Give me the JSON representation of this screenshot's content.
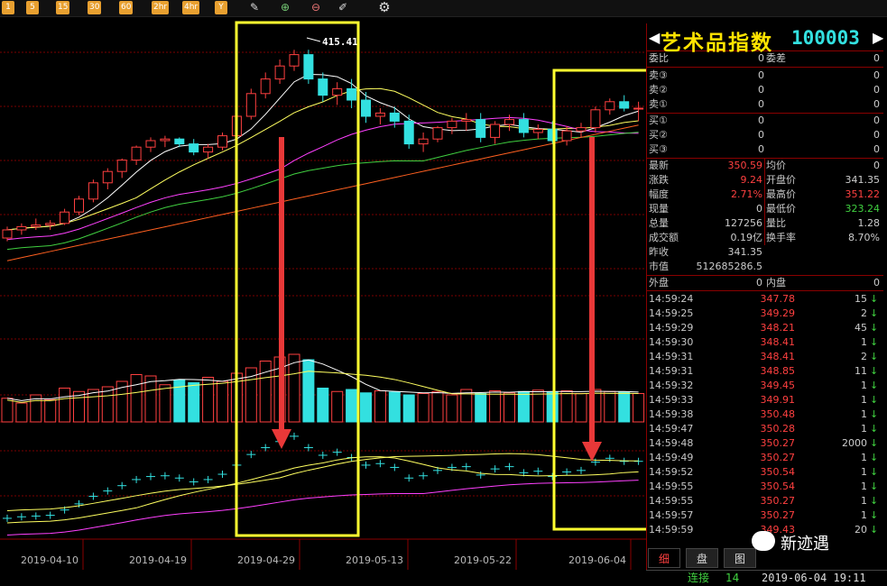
{
  "toolbar": {
    "periods": [
      "1",
      "5",
      "15",
      "30",
      "60",
      "2hr",
      "4hr",
      "Y"
    ],
    "icons": [
      "draw-tool-icon",
      "zoom-in-icon",
      "zoom-out-icon",
      "note-icon",
      "gear-icon"
    ]
  },
  "chart_data": {
    "type": "candlestick",
    "x_dates": [
      "2019-04-10",
      "2019-04-19",
      "2019-04-29",
      "2019-05-13",
      "2019-05-22",
      "2019-06-04"
    ],
    "peak_label": "415.41",
    "colors": {
      "up": "#ff4040",
      "down": "#33e0e0",
      "ma5": "#ffffff",
      "ma10": "#ffff60",
      "ma20": "#ff40ff",
      "ma60": "#40d040",
      "ma120": "#ff6020",
      "volume_avg": "#ffffff"
    },
    "candles": [
      [
        300,
        307,
        298,
        305
      ],
      [
        305,
        309,
        302,
        307
      ],
      [
        307,
        312,
        305,
        308
      ],
      [
        308,
        311,
        305,
        309
      ],
      [
        309,
        318,
        308,
        316
      ],
      [
        316,
        326,
        314,
        324
      ],
      [
        324,
        336,
        322,
        334
      ],
      [
        334,
        343,
        330,
        341
      ],
      [
        341,
        349,
        337,
        348
      ],
      [
        348,
        357,
        345,
        356
      ],
      [
        356,
        362,
        353,
        360
      ],
      [
        360,
        363,
        356,
        361
      ],
      [
        361,
        362,
        356,
        358
      ],
      [
        358,
        361,
        351,
        353
      ],
      [
        353,
        358,
        349,
        356
      ],
      [
        356,
        365,
        354,
        363
      ],
      [
        363,
        378,
        361,
        375
      ],
      [
        375,
        392,
        373,
        389
      ],
      [
        389,
        402,
        386,
        398
      ],
      [
        398,
        410,
        395,
        406
      ],
      [
        406,
        416,
        403,
        413
      ],
      [
        413,
        416,
        395,
        398
      ],
      [
        398,
        402,
        384,
        388
      ],
      [
        388,
        396,
        382,
        392
      ],
      [
        392,
        398,
        380,
        385
      ],
      [
        385,
        390,
        371,
        375
      ],
      [
        375,
        380,
        370,
        377
      ],
      [
        377,
        381,
        368,
        372
      ],
      [
        372,
        376,
        355,
        358
      ],
      [
        358,
        365,
        353,
        361
      ],
      [
        361,
        369,
        359,
        368
      ],
      [
        368,
        374,
        364,
        372
      ],
      [
        372,
        377,
        366,
        373
      ],
      [
        373,
        377,
        359,
        362
      ],
      [
        362,
        372,
        358,
        370
      ],
      [
        370,
        376,
        366,
        373
      ],
      [
        373,
        377,
        362,
        365
      ],
      [
        365,
        370,
        361,
        367
      ],
      [
        367,
        372,
        358,
        360
      ],
      [
        360,
        369,
        357,
        366
      ],
      [
        366,
        371,
        362,
        368
      ],
      [
        368,
        381,
        365,
        379
      ],
      [
        379,
        386,
        376,
        384
      ],
      [
        384,
        388,
        378,
        380
      ],
      [
        380,
        384,
        372,
        380
      ]
    ],
    "volumes": [
      0.34,
      0.34,
      0.34,
      0.34,
      0.34,
      0.34,
      0.34,
      0.34,
      0.34,
      0.34,
      0.34,
      0.34,
      0.34,
      0.34,
      0.34,
      0.34,
      0.34,
      0.34,
      0.34,
      0.34,
      0.85,
      0.85,
      0.85,
      0.85,
      0.85,
      0.85,
      0.85,
      0.85,
      0.85,
      0.85,
      0.85,
      0.85,
      0.85,
      0.85,
      0.85,
      0.85,
      0.85,
      0.85,
      0.85,
      0.85,
      0.85,
      0.85,
      0.85,
      0.85,
      0.85
    ]
  },
  "panel": {
    "title_name": "艺术品指数",
    "title_code": "100003",
    "weibi_label": "委比",
    "weibi_value": "0",
    "weicha_label": "委差",
    "weicha_value": "0",
    "asks": [
      {
        "label": "卖③",
        "price": "0",
        "vol": "0"
      },
      {
        "label": "卖②",
        "price": "0",
        "vol": "0"
      },
      {
        "label": "卖①",
        "price": "0",
        "vol": "0"
      }
    ],
    "bids": [
      {
        "label": "买①",
        "price": "0",
        "vol": "0"
      },
      {
        "label": "买②",
        "price": "0",
        "vol": "0"
      },
      {
        "label": "买③",
        "price": "0",
        "vol": "0"
      }
    ],
    "quote": [
      {
        "l1": "最新",
        "v1": "350.59",
        "c1": "#ff4040",
        "l2": "均价",
        "v2": "0",
        "c2": "#ccc"
      },
      {
        "l1": "涨跌",
        "v1": "9.24",
        "c1": "#ff4040",
        "l2": "开盘价",
        "v2": "341.35",
        "c2": "#ccc"
      },
      {
        "l1": "幅度",
        "v1": "2.71%",
        "c1": "#ff4040",
        "l2": "最高价",
        "v2": "351.22",
        "c2": "#ff4040"
      },
      {
        "l1": "现量",
        "v1": "0",
        "c1": "#ccc",
        "l2": "最低价",
        "v2": "323.24",
        "c2": "#40d040"
      },
      {
        "l1": "总量",
        "v1": "127256",
        "c1": "#ccc",
        "l2": "量比",
        "v2": "1.28",
        "c2": "#ccc"
      },
      {
        "l1": "成交额",
        "v1": "0.19亿",
        "c1": "#ccc",
        "l2": "换手率",
        "v2": "8.70%",
        "c2": "#ccc"
      }
    ],
    "zuoshou_label": "昨收",
    "zuoshou_value": "341.35",
    "shizhi_label": "市值",
    "shizhi_value": "512685286.5",
    "waipan_label": "外盘",
    "waipan_value": "0",
    "neipan_label": "内盘",
    "neipan_value": "0",
    "ticks": [
      {
        "t": "14:59:24",
        "p": "347.78",
        "v": "15"
      },
      {
        "t": "14:59:25",
        "p": "349.29",
        "v": "2"
      },
      {
        "t": "14:59:29",
        "p": "348.21",
        "v": "45"
      },
      {
        "t": "14:59:30",
        "p": "348.41",
        "v": "1"
      },
      {
        "t": "14:59:31",
        "p": "348.41",
        "v": "2"
      },
      {
        "t": "14:59:31",
        "p": "348.85",
        "v": "11"
      },
      {
        "t": "14:59:32",
        "p": "349.45",
        "v": "1"
      },
      {
        "t": "14:59:33",
        "p": "349.91",
        "v": "1"
      },
      {
        "t": "14:59:38",
        "p": "350.48",
        "v": "1"
      },
      {
        "t": "14:59:47",
        "p": "350.28",
        "v": "1"
      },
      {
        "t": "14:59:48",
        "p": "350.27",
        "v": "2000"
      },
      {
        "t": "14:59:49",
        "p": "350.27",
        "v": "1"
      },
      {
        "t": "14:59:52",
        "p": "350.54",
        "v": "1"
      },
      {
        "t": "14:59:55",
        "p": "350.54",
        "v": "1"
      },
      {
        "t": "14:59:55",
        "p": "350.27",
        "v": "1"
      },
      {
        "t": "14:59:57",
        "p": "350.27",
        "v": "1"
      },
      {
        "t": "14:59:59",
        "p": "349.43",
        "v": "20"
      }
    ]
  },
  "tabs": [
    "细",
    "盘",
    "图"
  ],
  "status": {
    "lianjie_label": "连接",
    "lianjie_value": "14",
    "datetime": "2019-06-04 19:11"
  },
  "watermark": "新迹遇"
}
